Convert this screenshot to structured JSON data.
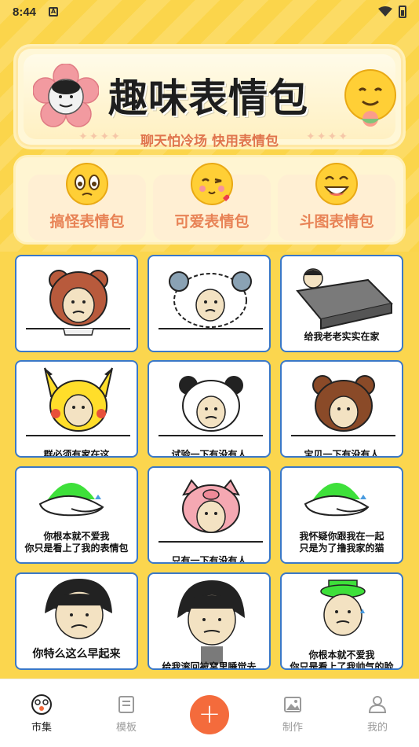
{
  "status": {
    "time": "8:44"
  },
  "banner": {
    "title": "趣味表情包",
    "subtitle": "聊天怕冷场 快用表情包"
  },
  "categories": [
    {
      "label": "搞怪表情包",
      "icon": "pleading-emoji-icon"
    },
    {
      "label": "可爱表情包",
      "icon": "blushing-heart-emoji-icon"
    },
    {
      "label": "斗图表情包",
      "icon": "grinning-emoji-icon"
    }
  ],
  "memes": [
    {
      "caption": "",
      "name": "monkey-hat-meme"
    },
    {
      "caption": "",
      "name": "sheep-hat-meme"
    },
    {
      "caption": "给我老老实实在家",
      "name": "bed-meme"
    },
    {
      "caption": "群必须有家在这",
      "name": "pikachu-hat-meme"
    },
    {
      "caption": "试验一下有没有人",
      "name": "panda-hat-meme"
    },
    {
      "caption": "宝贝一下有没有人",
      "name": "bear-hat-meme"
    },
    {
      "caption": "你根本就不爱我\n你只是看上了我的表情包",
      "name": "green-hat-meme-1"
    },
    {
      "caption": "只有一下有没有人",
      "name": "pig-hat-meme"
    },
    {
      "caption": "我怀疑你跟我在一起\n只是为了撸我家的猫",
      "name": "green-hat-meme-2"
    },
    {
      "caption": "你特么这么早起来",
      "name": "bowl-cut-meme-1"
    },
    {
      "caption": "给我滚回被窝里睡觉去",
      "name": "bowl-cut-meme-2"
    },
    {
      "caption": "你根本就不爱我\n你只是看上了我帅气的脸",
      "name": "green-hat-crying-meme"
    }
  ],
  "nav": {
    "items": [
      {
        "label": "市集",
        "icon": "market-icon"
      },
      {
        "label": "模板",
        "icon": "template-icon"
      },
      {
        "label": "制作",
        "icon": "image-edit-icon"
      },
      {
        "label": "我的",
        "icon": "profile-icon"
      }
    ],
    "fab": "+"
  },
  "colors": {
    "background": "#fbd64e",
    "accent": "#f46b3c",
    "tile_border": "#3a78c8",
    "category_text": "#e88356"
  }
}
